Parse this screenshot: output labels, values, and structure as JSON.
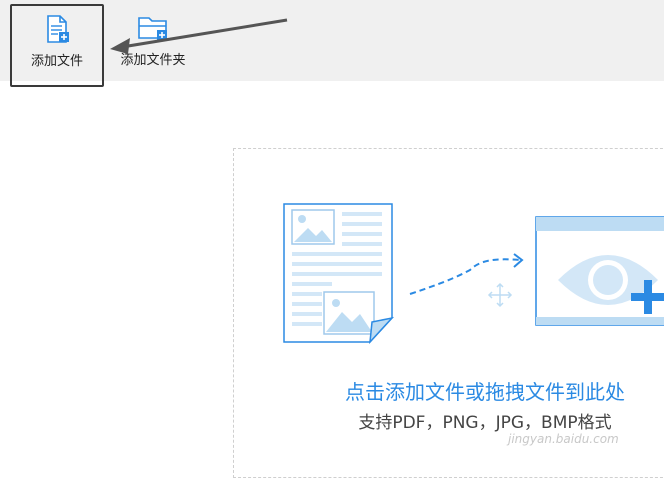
{
  "toolbar": {
    "add_file_label": "添加文件",
    "add_folder_label": "添加文件夹"
  },
  "dropzone": {
    "title": "点击添加文件或拖拽文件到此处",
    "subtitle": "支持PDF，PNG，JPG，BMP格式"
  },
  "watermark": "jingyan.baidu.com",
  "colors": {
    "accent": "#2b8ae3",
    "light_blue": "#bddcf3",
    "toolbar_bg": "#f0f0f0"
  }
}
